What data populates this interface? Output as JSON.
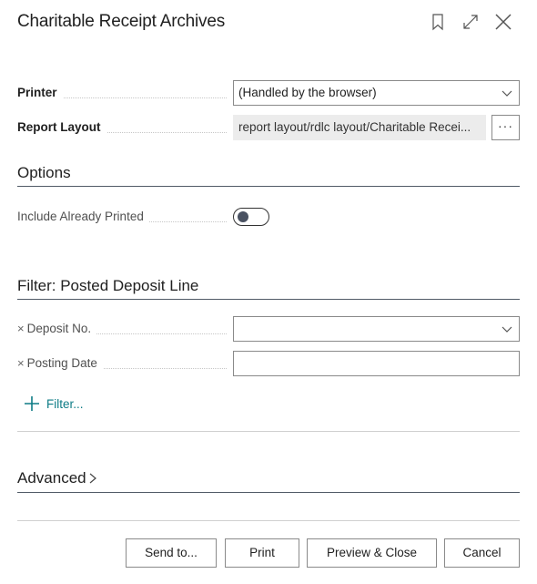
{
  "dialog": {
    "title": "Charitable Receipt Archives",
    "header_icons": [
      "bookmark-icon",
      "expand-icon",
      "close-icon"
    ]
  },
  "general": {
    "printer": {
      "label": "Printer",
      "value": "(Handled by the browser)"
    },
    "report_layout": {
      "label": "Report Layout",
      "value": "report layout/rdlc layout/Charitable Recei...",
      "lookup_label": "···"
    }
  },
  "options": {
    "title": "Options",
    "include_already_printed": {
      "label": "Include Already Printed",
      "value": false
    }
  },
  "filter": {
    "title": "Filter: Posted Deposit Line",
    "fields": [
      {
        "label": "Deposit No.",
        "value": "",
        "has_dropdown": true
      },
      {
        "label": "Posting Date",
        "value": "",
        "has_dropdown": false
      }
    ],
    "add_filter_label": "Filter..."
  },
  "advanced": {
    "title": "Advanced"
  },
  "footer": {
    "send_to": "Send to...",
    "print": "Print",
    "preview_close": "Preview & Close",
    "cancel": "Cancel"
  },
  "colors": {
    "accent": "#0e7c86",
    "rule": "#505a66"
  }
}
